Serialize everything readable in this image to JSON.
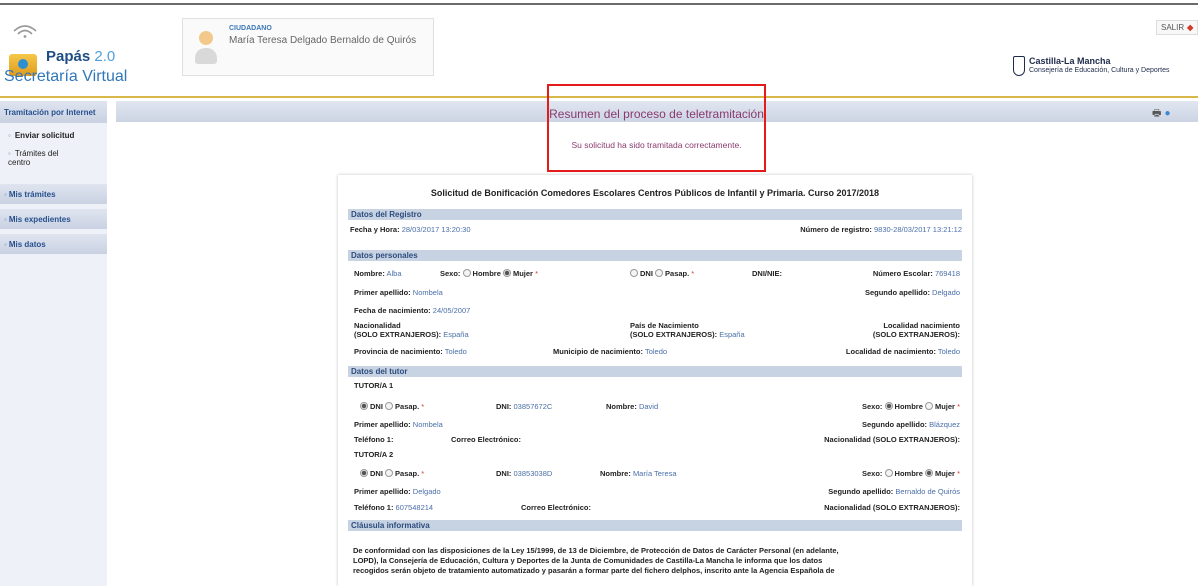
{
  "header": {
    "app_title": "Papás",
    "app_version": "2.0",
    "app_subtitle": "Secretaría Virtual",
    "user_role": "CIUDADANO",
    "user_name": "María Teresa Delgado Bernaldo de Quirós",
    "logout_label": "SALIR",
    "org_name": "Castilla-La Mancha",
    "org_dept": "Consejería de Educación, Cultura y Deportes"
  },
  "nav": {
    "section": "Tramitación por Internet",
    "sub_items": [
      "Enviar solicitud",
      "Trámites del",
      "centro"
    ],
    "items": [
      "Mis trámites",
      "Mis expedientes",
      "Mis datos"
    ]
  },
  "summary": {
    "title": "Resumen del proceso de teletramitación",
    "message": "Su solicitud ha sido tramitada correctamente."
  },
  "document": {
    "title": "Solicitud de Bonificación Comedores Escolares Centros Públicos de Infantil y Primaria. Curso 2017/2018",
    "registro": {
      "section": "Datos del Registro",
      "fecha_label": "Fecha y Hora:",
      "fecha_value": "28/03/2017 13:20:30",
      "numero_label": "Número de registro:",
      "numero_value": "9830-28/03/2017 13:21:12"
    },
    "personales": {
      "section": "Datos personales",
      "nombre_label": "Nombre:",
      "nombre_value": "Alba",
      "sexo_label": "Sexo:",
      "hombre": "Hombre",
      "mujer": "Mujer",
      "dni": "DNI",
      "pasap": "Pasap.",
      "dnie_label": "DNI/NIE:",
      "num_escolar_label": "Número Escolar:",
      "num_escolar_value": "769418",
      "primer_ap_label": "Primer apellido:",
      "primer_ap_value": "Nombela",
      "segundo_ap_label": "Segundo apellido:",
      "segundo_ap_value": "Delgado",
      "fecha_nac_label": "Fecha de nacimiento:",
      "fecha_nac_value": "24/05/2007",
      "nacionalidad_l1": "Nacionalidad",
      "nacionalidad_l2": "(SOLO EXTRANJEROS):",
      "nacionalidad_value": "España",
      "pais_l1": "País de Nacimiento",
      "pais_l2": "(SOLO EXTRANJEROS):",
      "pais_value": "España",
      "localidad_l1": "Localidad nacimiento",
      "localidad_l2": "(SOLO EXTRANJEROS):",
      "provincia_label": "Provincia de nacimiento:",
      "provincia_value": "Toledo",
      "municipio_label": "Municipio de nacimiento:",
      "municipio_value": "Toledo",
      "localidad_label": "Localidad de nacimiento:",
      "localidad_value": "Toledo"
    },
    "tutor": {
      "section": "Datos del tutor",
      "tutor1": {
        "heading": "TUTOR/A 1",
        "dni_label": "DNI:",
        "dni_value": "03857672C",
        "nombre_label": "Nombre:",
        "nombre_value": "David",
        "sexo_label": "Sexo:",
        "primer_ap_label": "Primer apellido:",
        "primer_ap_value": "Nombela",
        "segundo_ap_label": "Segundo apellido:",
        "segundo_ap_value": "Blázquez",
        "telefono_label": "Teléfono 1:",
        "telefono_value": "",
        "correo_label": "Correo Electrónico:",
        "nacionalidad_label": "Nacionalidad (SOLO EXTRANJEROS):"
      },
      "tutor2": {
        "heading": "TUTOR/A 2",
        "dni_label": "DNI:",
        "dni_value": "03853038D",
        "nombre_label": "Nombre:",
        "nombre_value": "María Teresa",
        "sexo_label": "Sexo:",
        "primer_ap_label": "Primer apellido:",
        "primer_ap_value": "Delgado",
        "segundo_ap_label": "Segundo apellido:",
        "segundo_ap_value": "Bernaldo de Quirós",
        "telefono_label": "Teléfono 1:",
        "telefono_value": "607548214",
        "correo_label": "Correo Electrónico:",
        "nacionalidad_label": "Nacionalidad (SOLO EXTRANJEROS):"
      }
    },
    "clausula": {
      "section": "Cláusula informativa",
      "lines": [
        "De conformidad con las disposiciones de la Ley 15/1999, de 13 de Diciembre, de Protección de Datos de Carácter Personal (en adelante,",
        "LOPD), la Consejería de Educación, Cultura y Deportes de la Junta de Comunidades de Castilla-La Mancha le informa que los datos",
        "recogidos serán objeto de tratamiento automatizado y pasarán a formar parte del fichero delphos, inscrito ante la Agencia Española de"
      ]
    }
  }
}
